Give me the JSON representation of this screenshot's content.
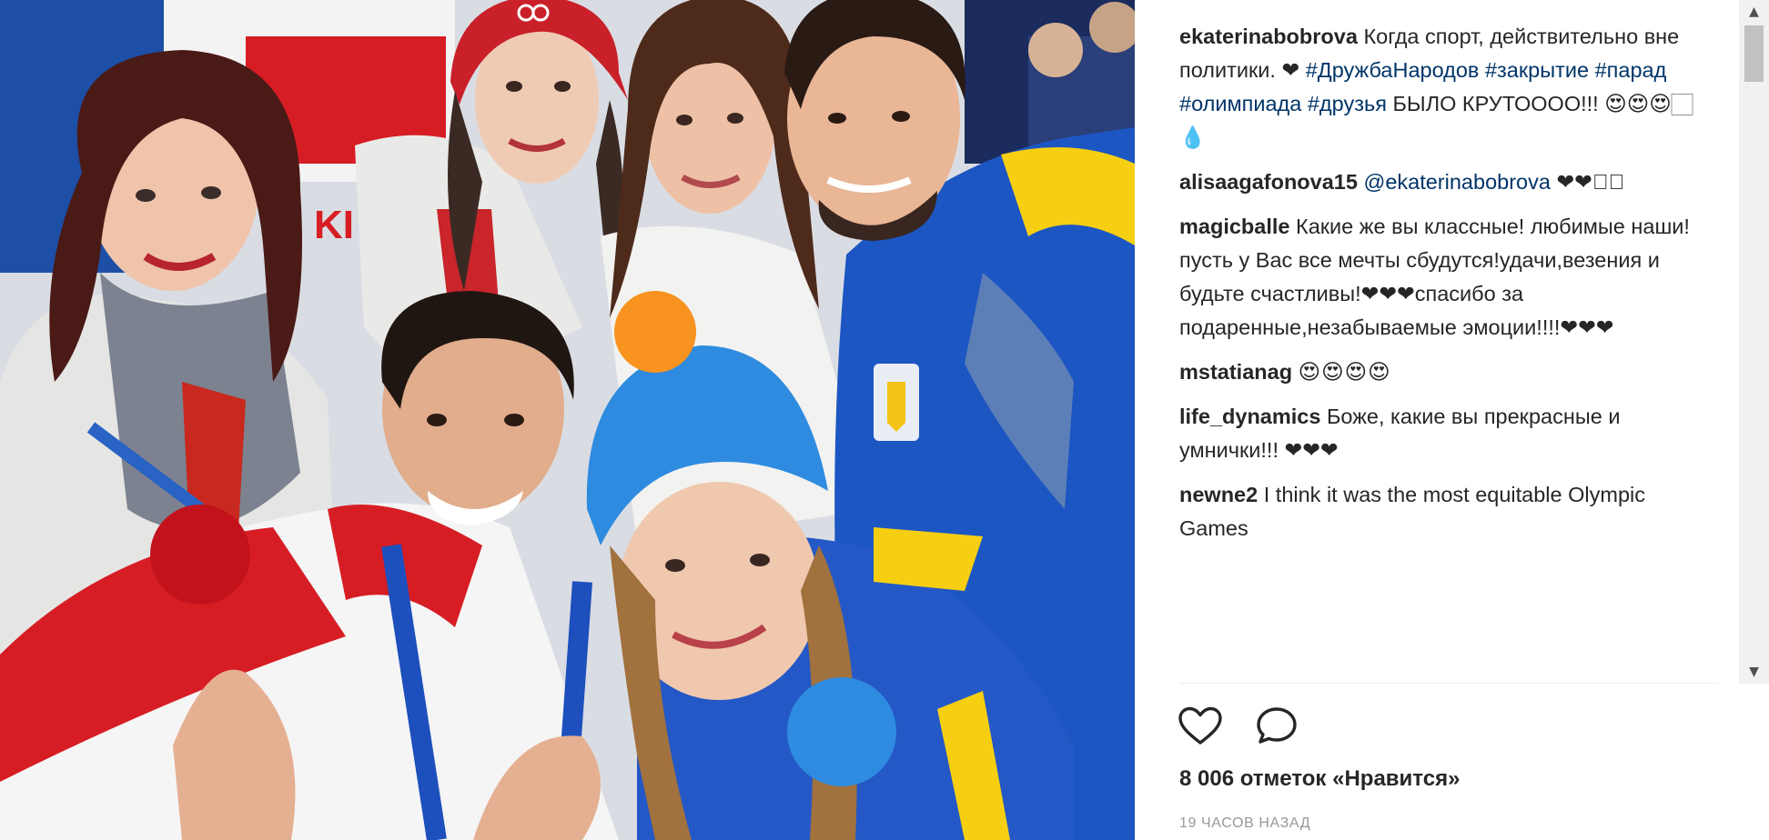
{
  "colors": {
    "username": "#262626",
    "hashtag": "#003569",
    "meta": "#999999",
    "divider": "#efefef"
  },
  "photo": {
    "icon": "group-selfie-photo",
    "jacket_text": "KI"
  },
  "comments": [
    {
      "user": "ekaterinabobrova",
      "text": "Когда спорт, действительно вне политики. ❤",
      "tags": "#ДружбаНародов #закрытие #парад #олимпиада #друзья",
      "text_after": " БЫЛО КРУТОООО!!! 😍😍😍🏻💧"
    },
    {
      "user": "alisaagafonova15",
      "mention": "@ekaterinabobrova",
      "text": " ❤❤❤🏻"
    },
    {
      "user": "magicballe",
      "text": "Какие же вы классные! любимые наши!пусть у Вас все мечты сбудутся!удачи,везения и будьте счастливы!❤❤❤спасибо за подаренные,незабываемые эмоции!!!!❤❤❤"
    },
    {
      "user": "mstatianag",
      "text": "😍😍😍😍"
    },
    {
      "user": "life_dynamics",
      "text": "Боже, какие вы прекрасные и умнички!!! ❤❤❤"
    },
    {
      "user": "newne2",
      "text": "I think it was the most equitable Olympic Games"
    }
  ],
  "actions": {
    "like_icon": "heart-icon",
    "comment_icon": "comment-icon"
  },
  "likes": "8 006 отметок «Нравится»",
  "timestamp": "19 часов назад",
  "scrollbar": {
    "up_arrow": "▲",
    "down_arrow": "▼"
  }
}
